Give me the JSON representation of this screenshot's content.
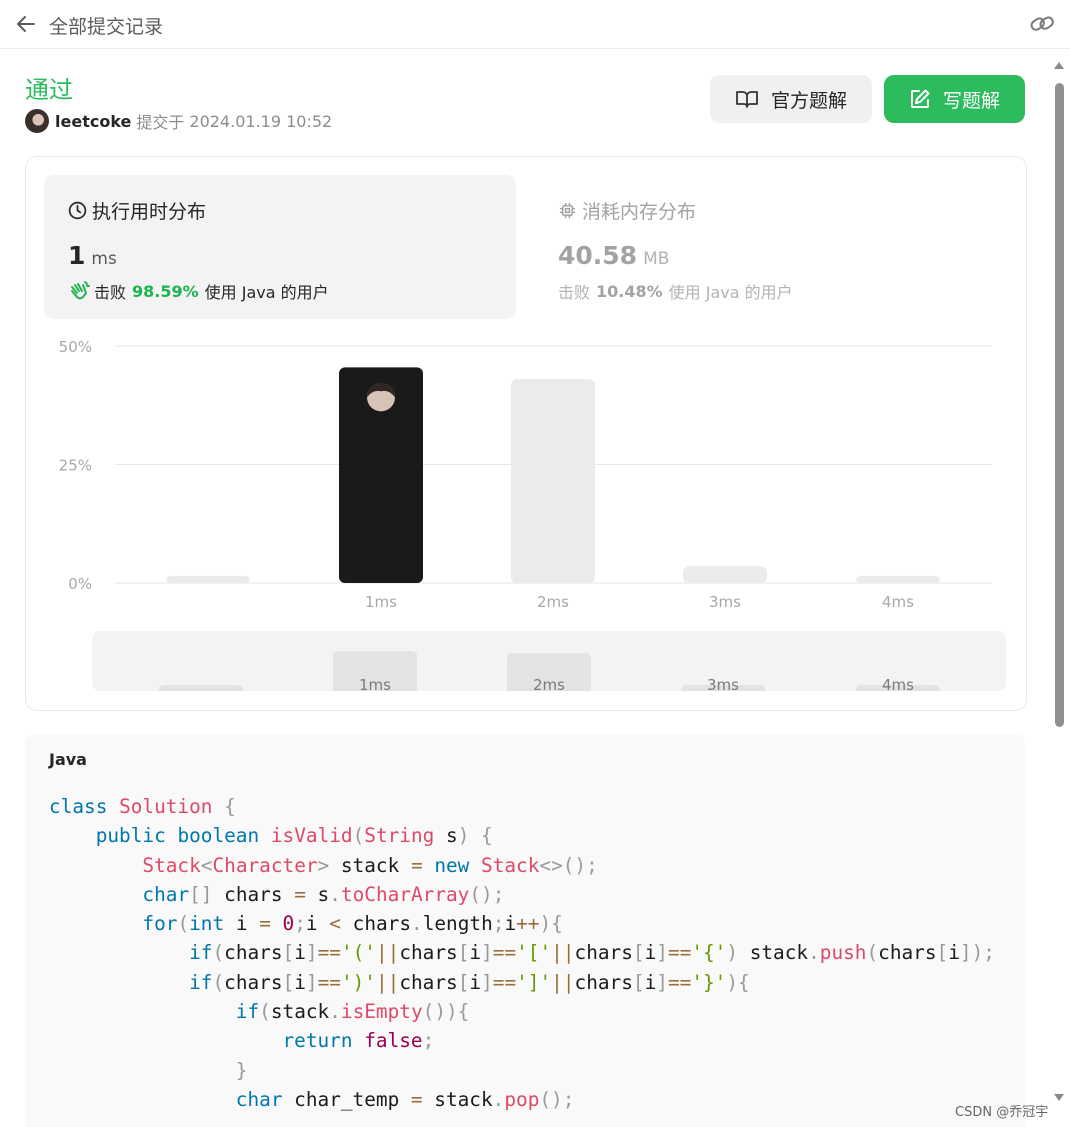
{
  "topbar": {
    "title": "全部提交记录",
    "back_icon": "arrow-left-icon",
    "link_icon": "link-icon"
  },
  "submission": {
    "status": "通过",
    "status_color": "#2cbb5d",
    "username": "leetcoke",
    "submitted_label": "提交于",
    "submitted_time": "2024.01.19 10:52"
  },
  "buttons": {
    "official": "官方题解",
    "write": "写题解"
  },
  "runtime": {
    "title": "执行用时分布",
    "value": "1",
    "unit": "ms",
    "beats_prefix": "击败",
    "beats_pct": "98.59%",
    "beats_suffix": "使用 Java 的用户",
    "pct_color": "#1db34f"
  },
  "memory": {
    "title": "消耗内存分布",
    "value": "40.58",
    "unit": "MB",
    "beats_prefix": "击败",
    "beats_pct": "10.48%",
    "beats_suffix": "使用 Java 的用户"
  },
  "chart_data": {
    "type": "bar",
    "categories": [
      "0ms",
      "1ms",
      "2ms",
      "3ms",
      "4ms"
    ],
    "tick_labels": [
      "",
      "1ms",
      "2ms",
      "3ms",
      "4ms"
    ],
    "values": [
      1.5,
      45.5,
      43,
      3.5,
      1.5
    ],
    "highlight_index": 1,
    "yticks": [
      "50%",
      "25%",
      "0%"
    ],
    "ylim": [
      0,
      50
    ],
    "grid": true,
    "colors": {
      "bar": "#ebebeb",
      "highlight": "#1a1a1a"
    }
  },
  "code": {
    "language": "Java",
    "lines": [
      [
        [
          "k",
          "class"
        ],
        [
          "p",
          " "
        ],
        [
          "t",
          "Solution"
        ],
        [
          "p",
          " {"
        ]
      ],
      [
        [
          "p",
          "    "
        ],
        [
          "k",
          "public"
        ],
        [
          "p",
          " "
        ],
        [
          "k",
          "boolean"
        ],
        [
          "p",
          " "
        ],
        [
          "f",
          "isValid"
        ],
        [
          "p",
          "("
        ],
        [
          "t",
          "String"
        ],
        [
          "n",
          " s"
        ],
        [
          "p",
          ") {"
        ]
      ],
      [
        [
          "p",
          "        "
        ],
        [
          "t",
          "Stack"
        ],
        [
          "p",
          "<"
        ],
        [
          "t",
          "Character"
        ],
        [
          "p",
          "> "
        ],
        [
          "n",
          "stack"
        ],
        [
          "o",
          " = "
        ],
        [
          "k",
          "new"
        ],
        [
          "p",
          " "
        ],
        [
          "t",
          "Stack"
        ],
        [
          "p",
          "<>();"
        ]
      ],
      [
        [
          "p",
          "        "
        ],
        [
          "k",
          "char"
        ],
        [
          "p",
          "[] "
        ],
        [
          "n",
          "chars"
        ],
        [
          "o",
          " = "
        ],
        [
          "n",
          "s"
        ],
        [
          "p",
          "."
        ],
        [
          "f",
          "toCharArray"
        ],
        [
          "p",
          "();"
        ]
      ],
      [
        [
          "p",
          "        "
        ],
        [
          "k",
          "for"
        ],
        [
          "p",
          "("
        ],
        [
          "k",
          "int"
        ],
        [
          "n",
          " i"
        ],
        [
          "o",
          " = "
        ],
        [
          "m",
          "0"
        ],
        [
          "p",
          ";"
        ],
        [
          "n",
          "i"
        ],
        [
          "o",
          " < "
        ],
        [
          "n",
          "chars"
        ],
        [
          "p",
          "."
        ],
        [
          "n",
          "length"
        ],
        [
          "p",
          ";"
        ],
        [
          "n",
          "i"
        ],
        [
          "o",
          "++"
        ],
        [
          "p",
          "){"
        ]
      ],
      [
        [
          "p",
          "            "
        ],
        [
          "k",
          "if"
        ],
        [
          "p",
          "("
        ],
        [
          "n",
          "chars"
        ],
        [
          "p",
          "["
        ],
        [
          "n",
          "i"
        ],
        [
          "p",
          "]"
        ],
        [
          "o",
          "=="
        ],
        [
          "s",
          "'('"
        ],
        [
          "o",
          "||"
        ],
        [
          "n",
          "chars"
        ],
        [
          "p",
          "["
        ],
        [
          "n",
          "i"
        ],
        [
          "p",
          "]"
        ],
        [
          "o",
          "=="
        ],
        [
          "s",
          "'['"
        ],
        [
          "o",
          "||"
        ],
        [
          "n",
          "chars"
        ],
        [
          "p",
          "["
        ],
        [
          "n",
          "i"
        ],
        [
          "p",
          "]"
        ],
        [
          "o",
          "=="
        ],
        [
          "s",
          "'{'"
        ],
        [
          "p",
          ") "
        ],
        [
          "n",
          "stack"
        ],
        [
          "p",
          "."
        ],
        [
          "f",
          "push"
        ],
        [
          "p",
          "("
        ],
        [
          "n",
          "chars"
        ],
        [
          "p",
          "["
        ],
        [
          "n",
          "i"
        ],
        [
          "p",
          "]);"
        ]
      ],
      [
        [
          "p",
          "            "
        ],
        [
          "k",
          "if"
        ],
        [
          "p",
          "("
        ],
        [
          "n",
          "chars"
        ],
        [
          "p",
          "["
        ],
        [
          "n",
          "i"
        ],
        [
          "p",
          "]"
        ],
        [
          "o",
          "=="
        ],
        [
          "s",
          "')'"
        ],
        [
          "o",
          "||"
        ],
        [
          "n",
          "chars"
        ],
        [
          "p",
          "["
        ],
        [
          "n",
          "i"
        ],
        [
          "p",
          "]"
        ],
        [
          "o",
          "=="
        ],
        [
          "s",
          "']'"
        ],
        [
          "o",
          "||"
        ],
        [
          "n",
          "chars"
        ],
        [
          "p",
          "["
        ],
        [
          "n",
          "i"
        ],
        [
          "p",
          "]"
        ],
        [
          "o",
          "=="
        ],
        [
          "s",
          "'}'"
        ],
        [
          "p",
          "){"
        ]
      ],
      [
        [
          "p",
          "                "
        ],
        [
          "k",
          "if"
        ],
        [
          "p",
          "("
        ],
        [
          "n",
          "stack"
        ],
        [
          "p",
          "."
        ],
        [
          "f",
          "isEmpty"
        ],
        [
          "p",
          "()){"
        ]
      ],
      [
        [
          "p",
          "                    "
        ],
        [
          "k",
          "return"
        ],
        [
          "p",
          " "
        ],
        [
          "r",
          "false"
        ],
        [
          "p",
          ";"
        ]
      ],
      [
        [
          "p",
          "                }"
        ]
      ],
      [
        [
          "p",
          "                "
        ],
        [
          "k",
          "char"
        ],
        [
          "n",
          " char_temp"
        ],
        [
          "o",
          " = "
        ],
        [
          "n",
          "stack"
        ],
        [
          "p",
          "."
        ],
        [
          "f",
          "pop"
        ],
        [
          "p",
          "();"
        ]
      ]
    ],
    "colors": {
      "k": "#0077aa",
      "t": "#dd4a68",
      "f": "#dd4a68",
      "s": "#669900",
      "o": "#9a6e3a",
      "m": "#990055",
      "r": "#990055",
      "p": "#999999",
      "n": "#1b1b1b"
    }
  },
  "watermark": "CSDN @乔冠宇"
}
